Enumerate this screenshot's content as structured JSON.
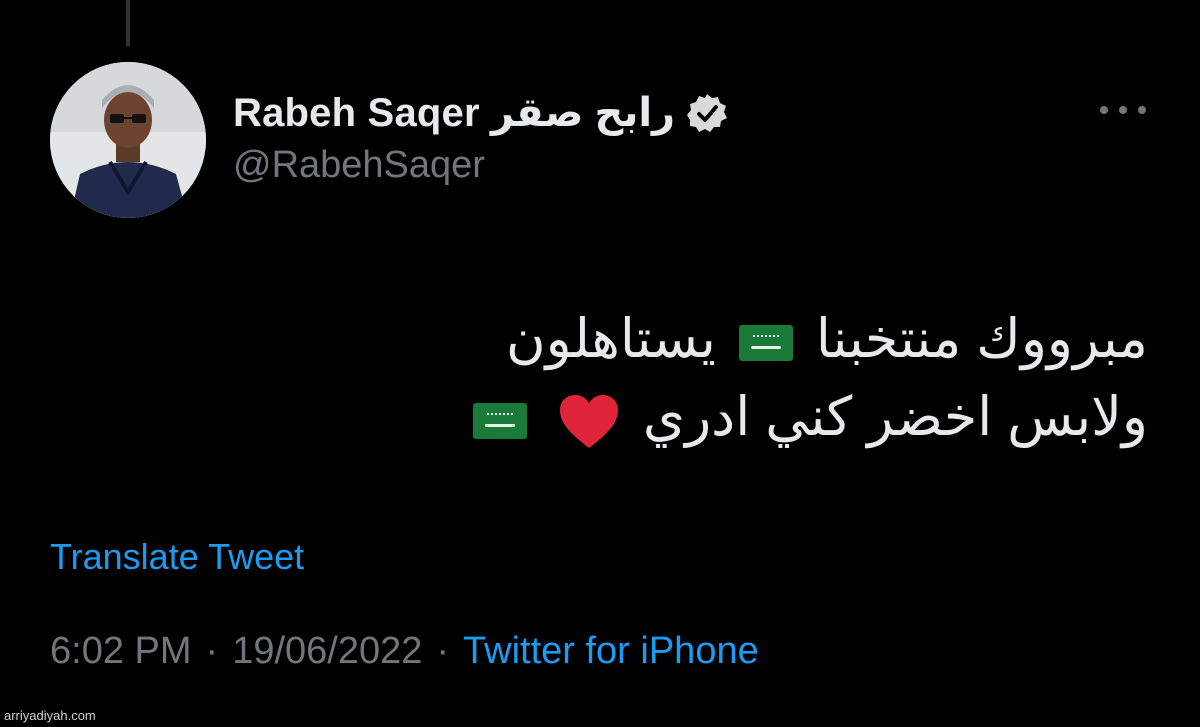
{
  "tweet": {
    "display_name": "Rabeh Saqer رابح صقر",
    "handle": "@RabehSaqer",
    "text_line_1_a": "مبرووك منتخبنا",
    "text_line_1_b": "يستاهلون",
    "text_line_2": "ولابس اخضر كني ادري",
    "translate_label": "Translate Tweet",
    "time": "6:02 PM",
    "separator": "·",
    "date": "19/06/2022",
    "source": "Twitter for iPhone",
    "icons": [
      "verified-badge-icon",
      "more-options-icon",
      "saudi-flag-emoji-icon",
      "red-heart-emoji-icon"
    ]
  },
  "watermark": "arriyadiyah.com",
  "colors": {
    "background": "#000000",
    "primary_text": "#e7e9ea",
    "secondary_text": "#71767b",
    "link": "#1d9bf0",
    "flag_green": "#1a7a3a",
    "heart_red": "#e0243a"
  }
}
